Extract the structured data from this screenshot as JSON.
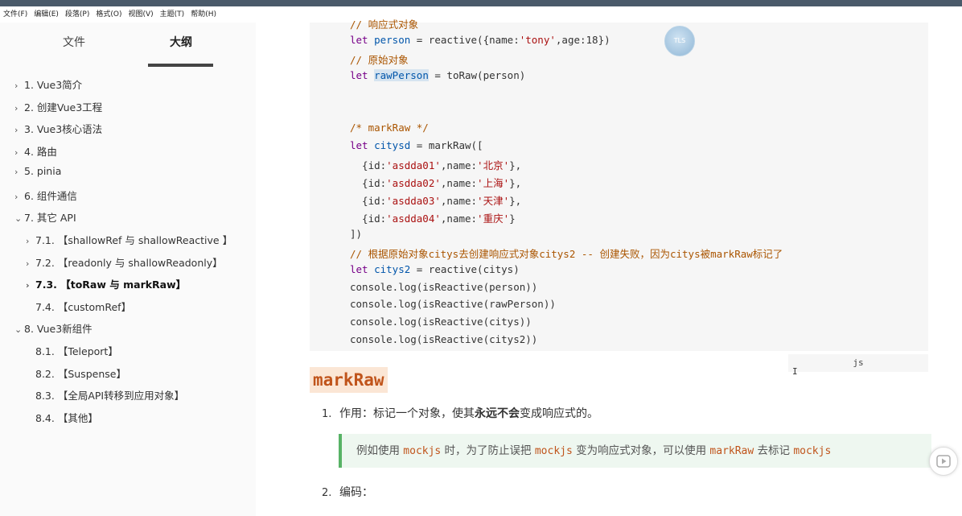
{
  "menubar": [
    "文件(F)",
    "编辑(E)",
    "段落(P)",
    "格式(O)",
    "视图(V)",
    "主题(T)",
    "帮助(H)"
  ],
  "sidebar": {
    "tabs": {
      "files": "文件",
      "outline": "大纲"
    },
    "items": [
      {
        "text": "1. Vue3简介",
        "chevron": "›",
        "indent": 0
      },
      {
        "text": "2. 创建Vue3工程",
        "chevron": "›",
        "indent": 0
      },
      {
        "text": "3. Vue3核心语法",
        "chevron": "›",
        "indent": 0
      },
      {
        "text": "4. 路由",
        "chevron": "›",
        "indent": 0
      },
      {
        "text": "5. pinia",
        "chevron": "›",
        "indent": 0
      },
      {
        "text": "6. 组件通信",
        "chevron": "›",
        "indent": 0
      },
      {
        "text": "7. 其它 API",
        "chevron": "⌄",
        "indent": 0
      },
      {
        "text": "7.1. 【shallowRef 与 shallowReactive 】",
        "chevron": "›",
        "indent": 1
      },
      {
        "text": "7.2. 【readonly 与 shallowReadonly】",
        "chevron": "›",
        "indent": 1
      },
      {
        "text": "7.3. 【toRaw 与 markRaw】",
        "chevron": "›",
        "indent": 1,
        "active": true
      },
      {
        "text": "7.4. 【customRef】",
        "chevron": "",
        "indent": 1
      },
      {
        "text": "8. Vue3新组件",
        "chevron": "⌄",
        "indent": 0
      },
      {
        "text": "8.1. 【Teleport】",
        "chevron": "",
        "indent": 1
      },
      {
        "text": "8.2. 【Suspense】",
        "chevron": "",
        "indent": 1
      },
      {
        "text": "8.3. 【全局API转移到应用对象】",
        "chevron": "",
        "indent": 1
      },
      {
        "text": "8.4. 【其他】",
        "chevron": "",
        "indent": 1
      }
    ]
  },
  "code": {
    "lines": [
      {
        "parts": [
          [
            "cm",
            "// 响应式对象"
          ]
        ]
      },
      {
        "parts": [
          [
            "kw",
            "let "
          ],
          [
            "var",
            "person"
          ],
          [
            "",
            " = reactive({name:"
          ],
          [
            "str",
            "'tony'"
          ],
          [
            "",
            ",age:18})"
          ]
        ]
      },
      {
        "parts": [
          [
            "cm",
            "// 原始对象"
          ]
        ]
      },
      {
        "parts": [
          [
            "kw",
            "let "
          ],
          [
            "var hl",
            "rawPerson"
          ],
          [
            "",
            " = toRaw(person)"
          ]
        ]
      },
      {
        "parts": []
      },
      {
        "parts": []
      },
      {
        "parts": [
          [
            "cm",
            "/* markRaw */"
          ]
        ]
      },
      {
        "parts": [
          [
            "kw",
            "let "
          ],
          [
            "var",
            "citysd"
          ],
          [
            "",
            " = markRaw(["
          ]
        ]
      },
      {
        "parts": [
          [
            "",
            "  {id:"
          ],
          [
            "str",
            "'asdda01'"
          ],
          [
            "",
            ",name:"
          ],
          [
            "str",
            "'北京'"
          ],
          [
            "",
            "},"
          ]
        ]
      },
      {
        "parts": [
          [
            "",
            "  {id:"
          ],
          [
            "str",
            "'asdda02'"
          ],
          [
            "",
            ",name:"
          ],
          [
            "str",
            "'上海'"
          ],
          [
            "",
            "},"
          ]
        ]
      },
      {
        "parts": [
          [
            "",
            "  {id:"
          ],
          [
            "str",
            "'asdda03'"
          ],
          [
            "",
            ",name:"
          ],
          [
            "str",
            "'天津'"
          ],
          [
            "",
            "},"
          ]
        ]
      },
      {
        "parts": [
          [
            "",
            "  {id:"
          ],
          [
            "str",
            "'asdda04'"
          ],
          [
            "",
            ",name:"
          ],
          [
            "str",
            "'重庆'"
          ],
          [
            "",
            "}"
          ]
        ]
      },
      {
        "parts": [
          [
            "",
            "])"
          ]
        ]
      },
      {
        "parts": [
          [
            "cm",
            "// 根据原始对象citys去创建响应式对象citys2 -- 创建失败，因为citys被markRaw标记了"
          ]
        ]
      },
      {
        "parts": [
          [
            "kw",
            "let "
          ],
          [
            "var",
            "citys2"
          ],
          [
            "",
            " = reactive(citys)"
          ]
        ]
      },
      {
        "parts": [
          [
            "",
            "console.log(isReactive(person))"
          ]
        ]
      },
      {
        "parts": [
          [
            "",
            "console.log(isReactive(rawPerson))"
          ]
        ]
      },
      {
        "parts": [
          [
            "",
            "console.log(isReactive(citys))"
          ]
        ]
      },
      {
        "parts": [
          [
            "",
            "console.log(isReactive(citys2))"
          ]
        ]
      }
    ],
    "language": "js"
  },
  "content": {
    "heading": "markRaw",
    "item1_num": "1.",
    "item1_pre": "作用：标记一个对象，使其",
    "item1_bold": "永远不会",
    "item1_post": "变成响应式的。",
    "quote": [
      [
        "text",
        "例如使用 "
      ],
      [
        "code",
        "mockjs"
      ],
      [
        "text",
        " 时，为了防止误把 "
      ],
      [
        "code",
        "mockjs"
      ],
      [
        "text",
        " 变为响应式对象，可以使用 "
      ],
      [
        "code",
        "markRaw"
      ],
      [
        "text",
        " 去标记 "
      ],
      [
        "code",
        "mockjs"
      ]
    ],
    "item2_num": "2.",
    "item2_text": "编码："
  },
  "overlay": {
    "avatar_text": "TLS"
  }
}
